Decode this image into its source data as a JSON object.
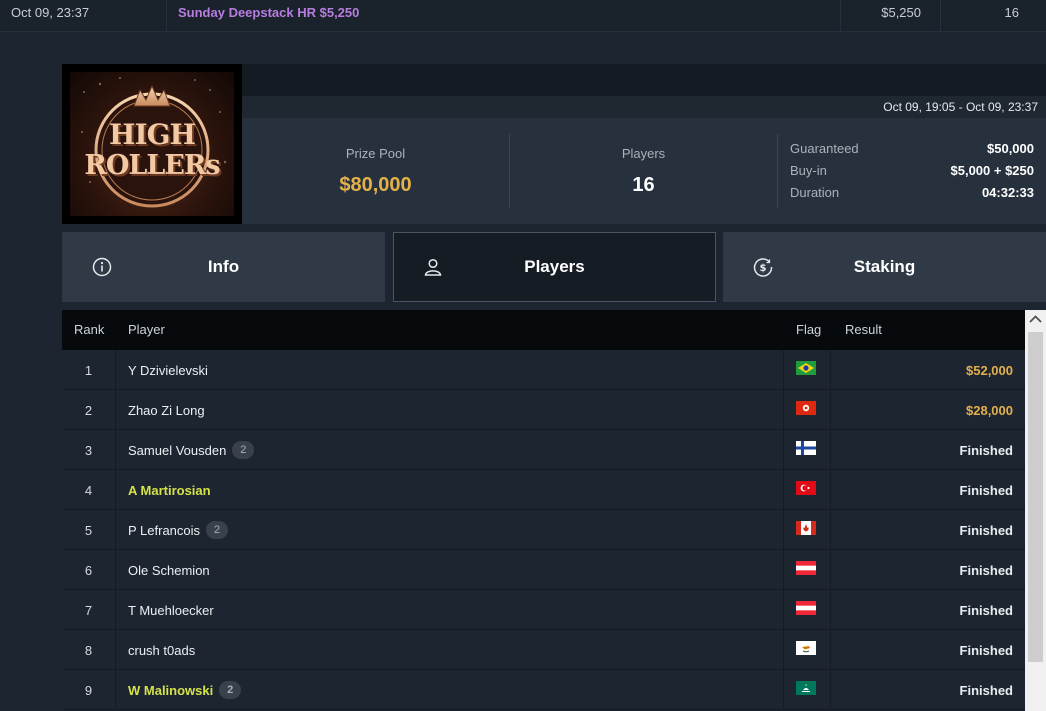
{
  "top_row": {
    "date": "Oct 09, 23:37",
    "name": "Sunday Deepstack HR $5,250",
    "buyin": "$5,250",
    "count": "16"
  },
  "logo": {
    "line1": "HIGH",
    "line2": "ROLLERs"
  },
  "header": {
    "date_range": "Oct 09, 19:05 - Oct 09, 23:37",
    "prize_pool_label": "Prize Pool",
    "prize_pool_value": "$80,000",
    "players_label": "Players",
    "players_value": "16",
    "guaranteed_label": "Guaranteed",
    "guaranteed_value": "$50,000",
    "buyin_label": "Buy-in",
    "buyin_value": "$5,000 + $250",
    "duration_label": "Duration",
    "duration_value": "04:32:33"
  },
  "tabs": [
    {
      "label": "Info",
      "icon": "info-icon",
      "active": false
    },
    {
      "label": "Players",
      "icon": "user-icon",
      "active": true
    },
    {
      "label": "Staking",
      "icon": "dollar-coin-icon",
      "active": false
    }
  ],
  "table": {
    "headers": {
      "rank": "Rank",
      "player": "Player",
      "flag": "Flag",
      "result": "Result"
    },
    "rows": [
      {
        "rank": "1",
        "player": "Y Dzivielevski",
        "badge": "",
        "flag": "brazil",
        "result": "$52,000",
        "money": true,
        "highlight": false
      },
      {
        "rank": "2",
        "player": "Zhao Zi Long",
        "badge": "",
        "flag": "hong-kong",
        "result": "$28,000",
        "money": true,
        "highlight": false
      },
      {
        "rank": "3",
        "player": "Samuel Vousden",
        "badge": "2",
        "flag": "finland",
        "result": "Finished",
        "money": false,
        "highlight": false
      },
      {
        "rank": "4",
        "player": "A Martirosian",
        "badge": "",
        "flag": "turkey",
        "result": "Finished",
        "money": false,
        "highlight": true
      },
      {
        "rank": "5",
        "player": "P Lefrancois",
        "badge": "2",
        "flag": "canada",
        "result": "Finished",
        "money": false,
        "highlight": false
      },
      {
        "rank": "6",
        "player": "Ole Schemion",
        "badge": "",
        "flag": "austria",
        "result": "Finished",
        "money": false,
        "highlight": false
      },
      {
        "rank": "7",
        "player": "T Muehloecker",
        "badge": "",
        "flag": "austria",
        "result": "Finished",
        "money": false,
        "highlight": false
      },
      {
        "rank": "8",
        "player": "crush t0ads",
        "badge": "",
        "flag": "cyprus",
        "result": "Finished",
        "money": false,
        "highlight": false
      },
      {
        "rank": "9",
        "player": "W Malinowski",
        "badge": "2",
        "flag": "macau",
        "result": "Finished",
        "money": false,
        "highlight": true
      }
    ]
  },
  "colors": {
    "money": "#e4b04a",
    "highlight_player": "#d6e24a",
    "tournament_name": "#b87de0"
  }
}
